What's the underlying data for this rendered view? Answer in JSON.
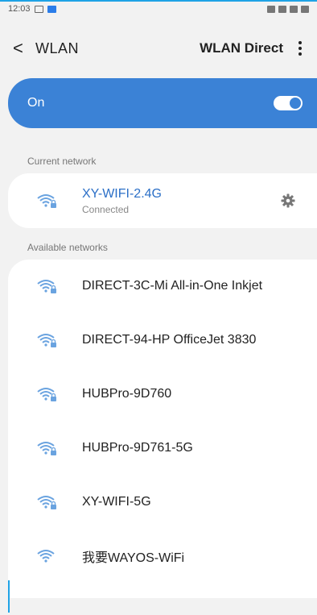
{
  "status_bar": {
    "time": "12:03"
  },
  "app_bar": {
    "title": "WLAN",
    "back_glyph": "<",
    "direct_label": "WLAN Direct"
  },
  "toggle": {
    "label": "On",
    "state": "on"
  },
  "current": {
    "section_label": "Current network",
    "name": "XY-WIFI-2.4G",
    "status": "Connected"
  },
  "available": {
    "section_label": "Available networks",
    "networks": [
      {
        "name": "DIRECT-3C-Mi All-in-One Inkjet",
        "secured": true
      },
      {
        "name": "DIRECT-94-HP OfficeJet 3830",
        "secured": true
      },
      {
        "name": "HUBPro-9D760",
        "secured": true
      },
      {
        "name": "HUBPro-9D761-5G",
        "secured": true
      },
      {
        "name": "XY-WIFI-5G",
        "secured": true
      },
      {
        "name": "我要WAYOS-WiFi",
        "secured": false
      }
    ]
  },
  "colors": {
    "accent": "#3b82d6",
    "link": "#2b6fc7",
    "wifi_icon": "#6aa3e0"
  }
}
